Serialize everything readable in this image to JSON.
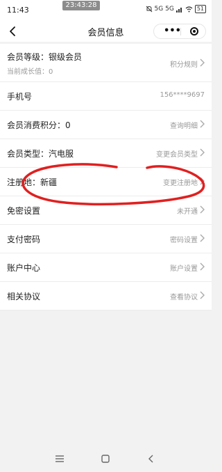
{
  "status_bar": {
    "time": "11:43",
    "recording_time": "23:43:28",
    "network": "5G 5G",
    "battery": "51"
  },
  "nav": {
    "title": "会员信息",
    "capsule_dots": "•••"
  },
  "rows": [
    {
      "label": "会员等级：银级会员",
      "sub": "当前成长值：0",
      "value": "积分规则"
    },
    {
      "label": "手机号",
      "value": "156****9697"
    },
    {
      "label": "会员消费积分：0",
      "value": "查询明细"
    },
    {
      "label": "会员类型：汽电服",
      "value": "变更会员类型"
    },
    {
      "label": "注册地：新疆",
      "value": "变更注册地"
    },
    {
      "label": "免密设置",
      "value": "未开通"
    },
    {
      "label": "支付密码",
      "value": "密码设置"
    },
    {
      "label": "账户中心",
      "value": "账户设置"
    },
    {
      "label": "相关协议",
      "value": "查看协议"
    }
  ],
  "colors": {
    "annotation": "#e02020",
    "background": "#f2f2f2",
    "muted_text": "#999999"
  }
}
